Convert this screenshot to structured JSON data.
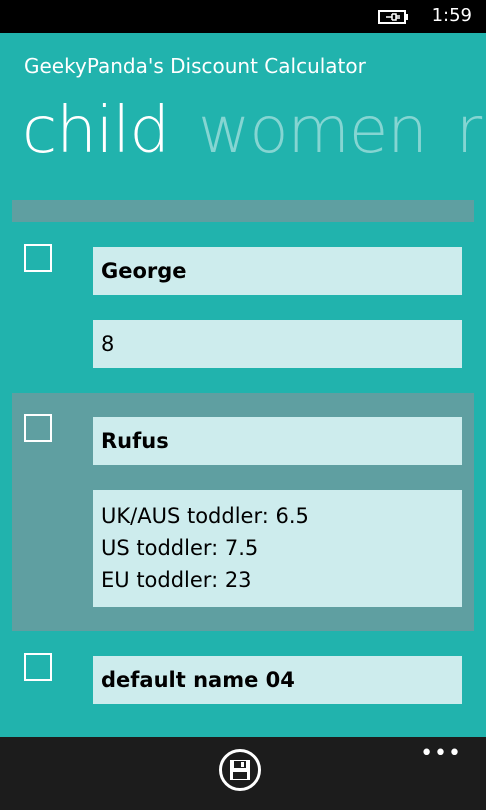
{
  "status_bar": {
    "time": "1:59",
    "battery_icon": "battery-charging-icon"
  },
  "app_title": "GeekyPanda's Discount Calculator",
  "pivot": {
    "headers": [
      "child",
      "women",
      "r"
    ],
    "active_index": 0
  },
  "items": [
    {
      "name": "George",
      "details": [
        "8"
      ],
      "checked": false,
      "selected": false
    },
    {
      "name": "Rufus",
      "details": [
        "UK/AUS toddler: 6.5",
        "US toddler: 7.5",
        "EU toddler: 23"
      ],
      "checked": false,
      "selected": true
    },
    {
      "name": "default name 04",
      "details": [],
      "checked": false,
      "selected": false
    }
  ],
  "app_bar": {
    "save_icon": "save-icon",
    "more_label": "•••"
  },
  "colors": {
    "background": "#21b3ad",
    "selected_item": "#5f9fa1",
    "field_bg": "#cdeced"
  }
}
